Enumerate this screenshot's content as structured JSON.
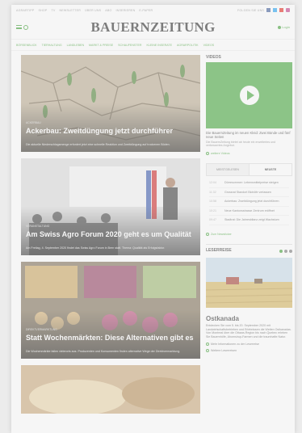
{
  "topbar": {
    "links": [
      "AGRARTIPP",
      "SHOP",
      "TV",
      "NEWSLETTER",
      "ÜBER UNS",
      "ABO",
      "INSERIEREN",
      "E-PAPER"
    ],
    "follow_label": "FOLGEN SIE UNS"
  },
  "header": {
    "logo": "BAUERNZEITUNG",
    "user_label": "Login"
  },
  "nav": {
    "items": [
      "BÖRSENBLICK",
      "TIERHALTUNG",
      "LANDLEBEN",
      "MARKT & PREISE",
      "SCHAUFENSTER",
      "KLEINE INSERATE",
      "AGRARPOLITIK",
      "VIDEOS"
    ]
  },
  "articles": [
    {
      "meta": "ACKERBAU",
      "title": "Ackerbau: Zweitdüngung jetzt durchführer",
      "teaser": "Die aktuelle Niederschlagsmenge erfordert jetzt eine schnelle Reaktion und Zweitdüngung auf trockenen Böden."
    },
    {
      "meta": "VERANSTALTUNG",
      "title": "Am Swiss Agro Forum 2020 geht es um Qualität",
      "teaser": "Am Freitag, 4. September 2020 findet das Swiss Agro Forum in Bern statt. Thema: Qualität als Erfolgsfaktor."
    },
    {
      "meta": "DIREKTVERMARKTUNG",
      "title": "Statt Wochenmärkten: Diese Alternativen gibt es",
      "teaser": "Die Wochenmärkte fallen vielerorts aus. Produzenten und Konsumenten finden alternative Wege der Direktvermarktung."
    },
    {
      "meta": "",
      "title": "",
      "teaser": ""
    }
  ],
  "videos": {
    "section_title": "VIDEOS",
    "caption": "Die BauernZeitung im neuen Kleid: Zwei Bünde und fünf neue Seiten",
    "subcaption": "Die BauernZeitung bietet ab heute ein erweitertes und verbessertes Angebot.",
    "more_label": "weitere Videos"
  },
  "tabs": {
    "items": [
      "MEISTGELESEN",
      "NEUSTE"
    ],
    "active_index": 1
  },
  "news": [
    {
      "time": "12:04",
      "headline": "Dürresommer: Lebensmittelpreise steigen"
    },
    {
      "time": "11:32",
      "headline": "Grossrat Standort Biohöfe verlassen"
    },
    {
      "time": "10:58",
      "headline": "Ackerbau: Zweitdüngung jetzt durchführen"
    },
    {
      "time": "10:21",
      "headline": "Neue Kantonsstrasse Zentrum eröffnet"
    },
    {
      "time": "09:47",
      "headline": "Stadtrat: Die Jahresbilanz zeigt Wachstum"
    }
  ],
  "news_more_label": "Zum Newsticker",
  "leserreise": {
    "section_title": "LESERREISE",
    "title": "Ostkanada",
    "text": "Entdecken Sie vom 5. bis 20. September 2020 mit Landwirtschaftsbetrieben und Erlebnissen die Weiten Ostkanadas. Von Montreal über die Ottawa-Region bis nach Quebec erleben Sie Bauernhöfe, Ahornsirup-Farmen und die traumhafte Natur.",
    "link1": "Mehr Informationen zu der Leserreise",
    "link2": "Weitere Leserreisen"
  },
  "colors": {
    "accent": "#3a9d2e",
    "video_bg": "#3fa535"
  }
}
